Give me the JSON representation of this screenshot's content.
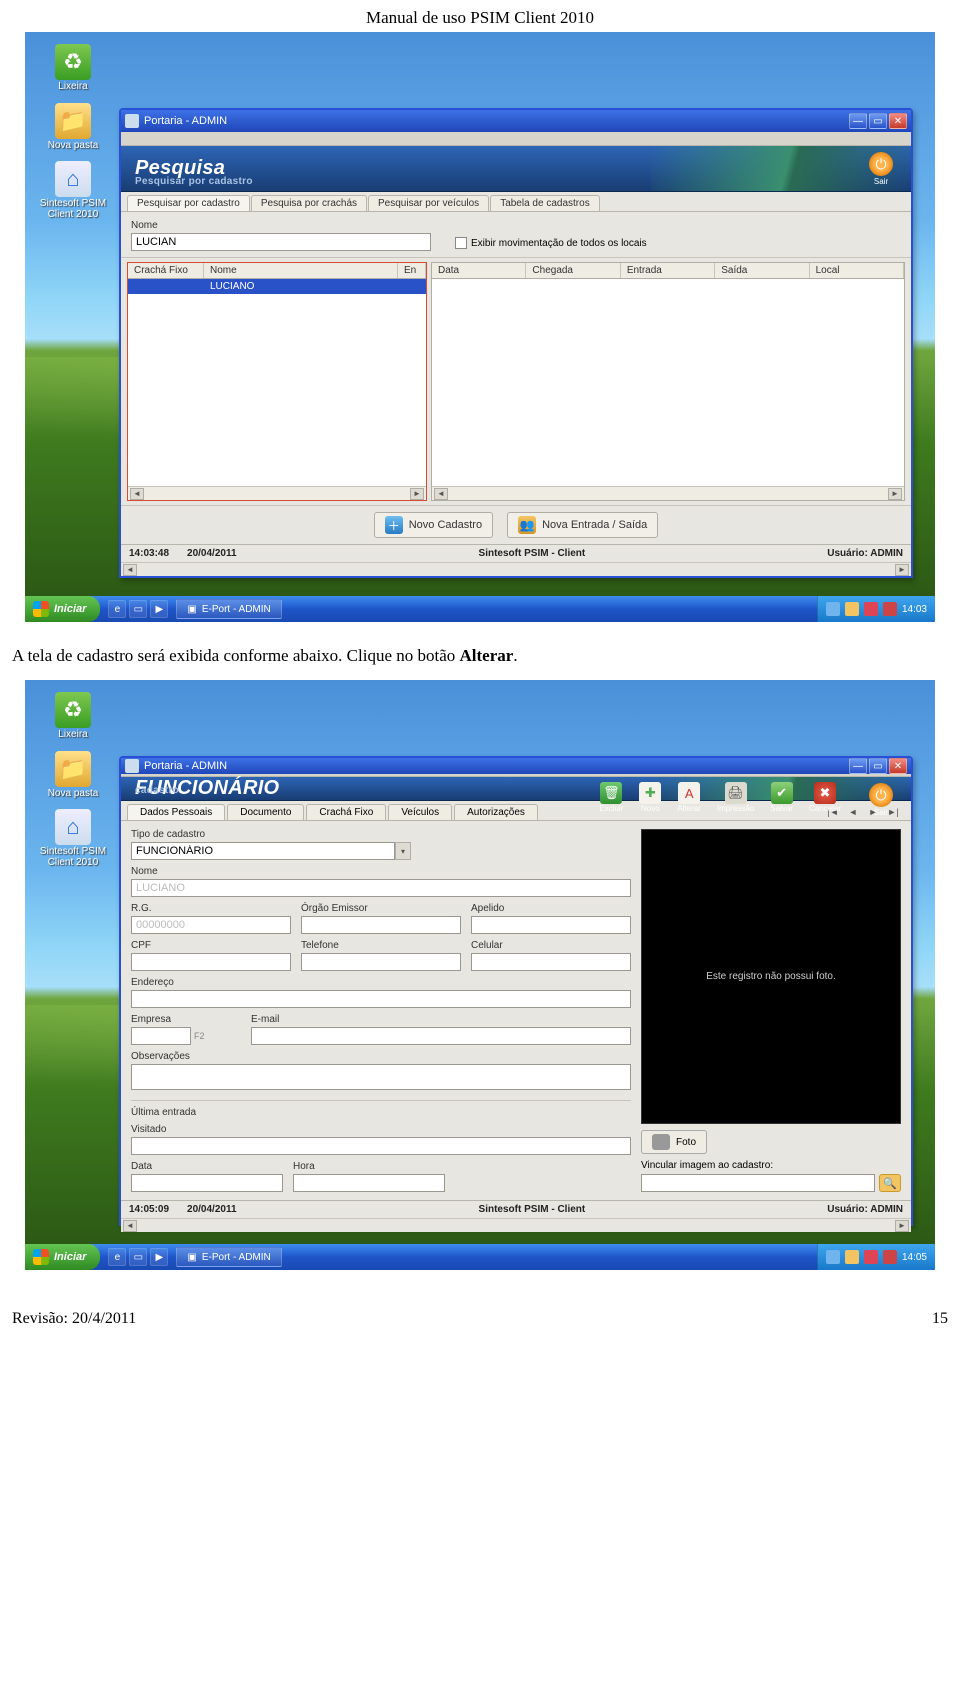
{
  "doc": {
    "header": "Manual de uso PSIM Client 2010",
    "caption_prefix": "A tela de cadastro será exibida conforme abaixo. Clique no botão ",
    "caption_bold": "Alterar",
    "caption_suffix": ".",
    "footer_left": "Revisão: 20/4/2011",
    "footer_right": "15"
  },
  "desktop": {
    "icons": [
      {
        "name": "lixeira",
        "label": "Lixeira"
      },
      {
        "name": "nova-pasta",
        "label": "Nova pasta"
      },
      {
        "name": "psim",
        "label": "Sintesoft PSIM Client 2010"
      }
    ],
    "start_label": "Iniciar",
    "task_app": "E-Port - ADMIN"
  },
  "shot1": {
    "window_title": "Portaria - ADMIN",
    "banner_title": "Pesquisa",
    "banner_sub": "Pesquisar por cadastro",
    "sair": "Sair",
    "tabs": [
      "Pesquisar por cadastro",
      "Pesquisa por crachás",
      "Pesquisar por veículos",
      "Tabela de cadastros"
    ],
    "nome_label": "Nome",
    "nome_value": "LUCIAN",
    "chk_label": "Exibir movimentação de todos os locais",
    "left_cols": [
      "Crachá Fixo",
      "Nome",
      "En"
    ],
    "left_row": [
      "",
      "LUCIANO",
      ""
    ],
    "right_cols": [
      "Data",
      "Chegada",
      "Entrada",
      "Saída",
      "Local"
    ],
    "btn_novo": "Novo Cadastro",
    "btn_entrada": "Nova Entrada / Saída",
    "status_time": "14:03:48",
    "status_date": "20/04/2011",
    "status_app": "Sintesoft PSIM - Client",
    "status_user": "Usuário: ADMIN",
    "tray_time": "14:03"
  },
  "shot2": {
    "window_title": "Portaria - ADMIN",
    "banner_title": "FUNCIONÁRIO",
    "banner_sub": "cadastro",
    "toolbar": [
      {
        "key": "excluir",
        "label": "Excluir"
      },
      {
        "key": "novo",
        "label": "Novo"
      },
      {
        "key": "alterar",
        "label": "Alterar"
      },
      {
        "key": "imprimir",
        "label": "Impressão"
      },
      {
        "key": "salvar",
        "label": "Salvar"
      },
      {
        "key": "cancelar",
        "label": "Cancelar"
      }
    ],
    "sair": "Sair",
    "tabs": [
      "Dados Pessoais",
      "Documento",
      "Crachá Fixo",
      "Veículos",
      "Autorizações"
    ],
    "fields": {
      "tipo_label": "Tipo de cadastro",
      "tipo_value": "FUNCIONÁRIO",
      "nome_label": "Nome",
      "nome_value": "LUCIANO",
      "rg_label": "R.G.",
      "rg_value": "00000000",
      "orgao_label": "Órgão Emissor",
      "apelido_label": "Apelido",
      "cpf_label": "CPF",
      "tel_label": "Telefone",
      "cel_label": "Celular",
      "end_label": "Endereço",
      "emp_label": "Empresa",
      "emp_hint": "F2",
      "email_label": "E-mail",
      "obs_label": "Observações",
      "ult_label": "Última entrada",
      "vis_label": "Visitado",
      "data_label": "Data",
      "hora_label": "Hora"
    },
    "photo_msg": "Este registro não possui foto.",
    "foto_btn": "Foto",
    "vinc_label": "Vincular imagem ao cadastro:",
    "status_time": "14:05:09",
    "status_date": "20/04/2011",
    "status_app": "Sintesoft PSIM - Client",
    "status_user": "Usuário: ADMIN",
    "tray_time": "14:05"
  }
}
